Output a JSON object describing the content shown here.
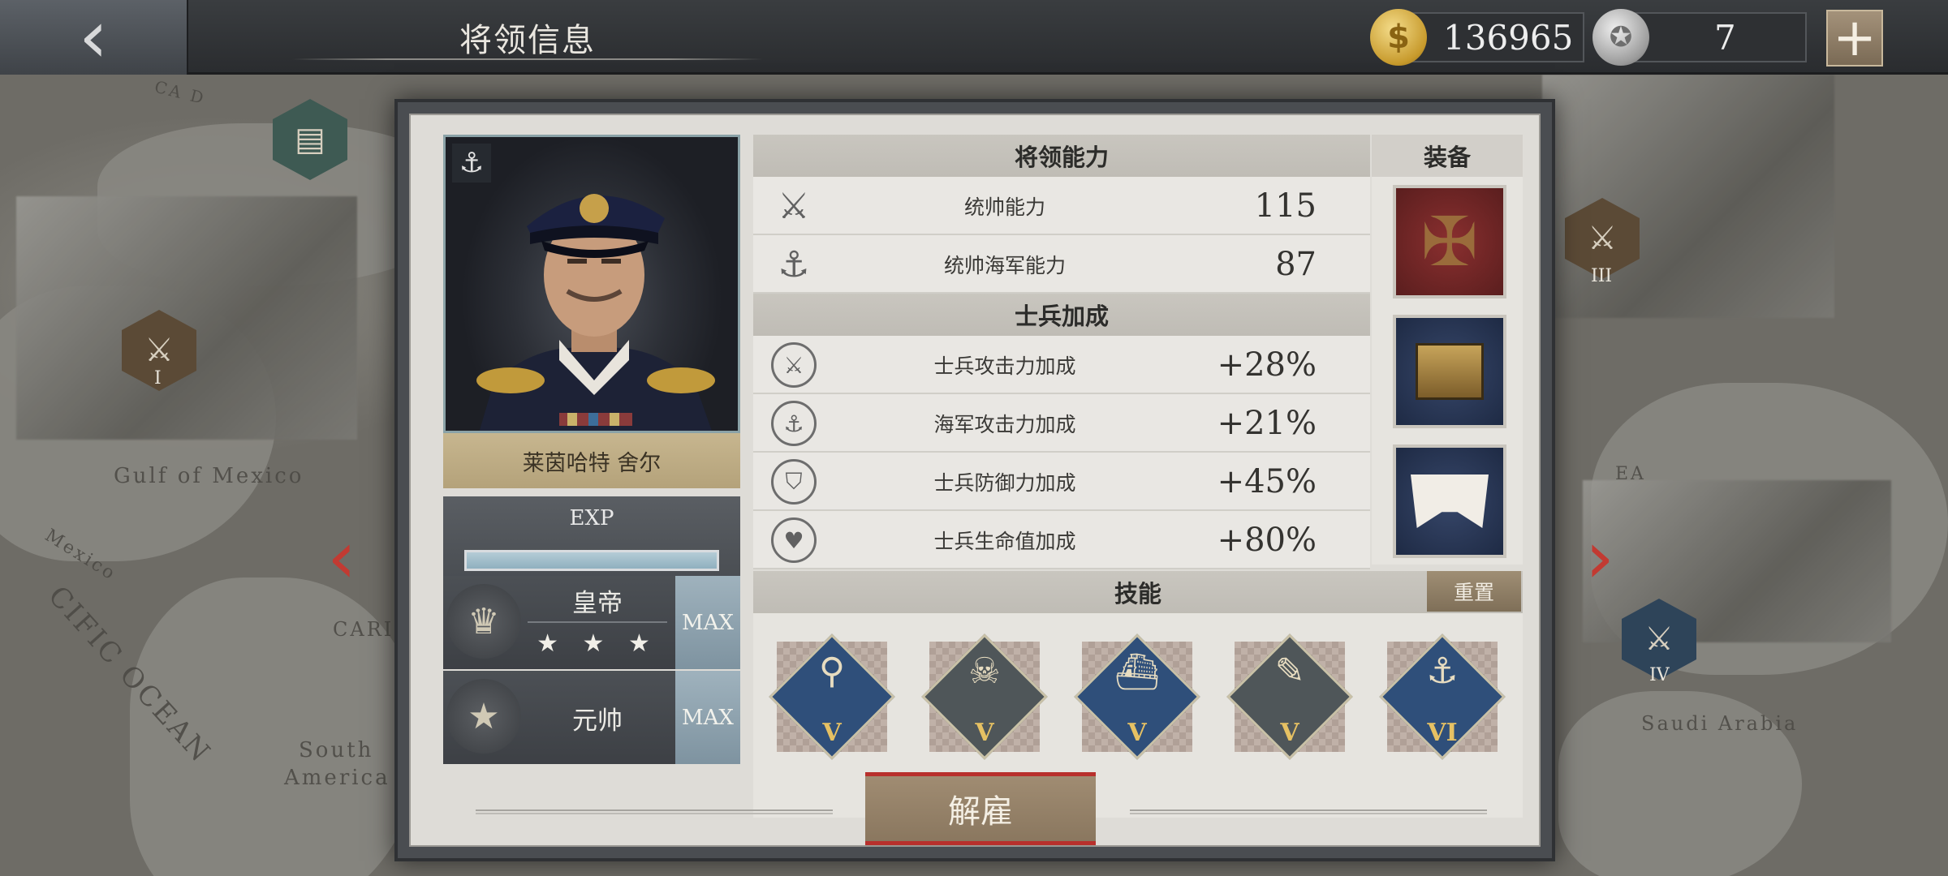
{
  "header": {
    "title": "将领信息",
    "back_icon": "chevron-left-icon",
    "gold": "136965",
    "medals": "7",
    "add_icon": "plus-icon"
  },
  "map": {
    "labels": [
      "Gulf of Mexico",
      "Mexico",
      "South",
      "America",
      "Saudi Arabia",
      "CIFIC OCEAN",
      "CARI",
      "CA D",
      "EA"
    ],
    "markers": [
      "I",
      "III",
      "IV"
    ]
  },
  "commander": {
    "name": "莱茵哈特 舍尔",
    "exp_label": "EXP",
    "exp_progress": 1.0,
    "ranks": [
      {
        "name": "皇帝",
        "stars": "★ ★ ★",
        "max": "MAX",
        "icon": "crown-icon"
      },
      {
        "name": "元帅",
        "max": "MAX",
        "icon": "marshal-insignia-icon"
      }
    ]
  },
  "abilities": {
    "header": "将领能力",
    "rows": [
      {
        "label": "统帅能力",
        "value": "115",
        "icon": "crossed-swords-icon"
      },
      {
        "label": "统帅海军能力",
        "value": "87",
        "icon": "anchor-icon"
      }
    ]
  },
  "bonuses": {
    "header": "士兵加成",
    "rows": [
      {
        "label": "士兵攻击力加成",
        "value": "+28%",
        "icon": "attack-plus-icon"
      },
      {
        "label": "海军攻击力加成",
        "value": "+21%",
        "icon": "naval-plus-icon"
      },
      {
        "label": "士兵防御力加成",
        "value": "+45%",
        "icon": "shield-plus-icon"
      },
      {
        "label": "士兵生命值加成",
        "value": "+80%",
        "icon": "heart-plus-icon"
      }
    ]
  },
  "equipment": {
    "header": "装备",
    "items": [
      "cross-medal-icon",
      "telegraph-box-icon",
      "uniform-collar-icon"
    ]
  },
  "skills": {
    "header": "技能",
    "reset": "重置",
    "items": [
      {
        "icon": "battleship-location-icon",
        "level": "V"
      },
      {
        "icon": "fire-skull-icon",
        "level": "V"
      },
      {
        "icon": "battleship-icon",
        "level": "V"
      },
      {
        "icon": "artillery-icon",
        "level": "V"
      },
      {
        "icon": "anchor-laurel-icon",
        "level": "VI"
      }
    ]
  },
  "actions": {
    "dismiss": "解雇"
  }
}
